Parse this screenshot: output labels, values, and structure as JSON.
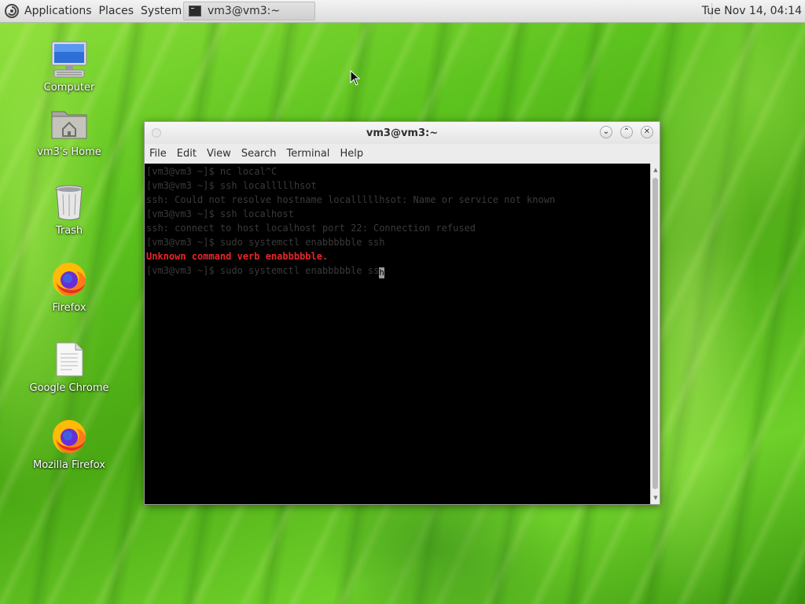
{
  "top_panel": {
    "menus": [
      "Applications",
      "Places",
      "System"
    ],
    "task_title": "vm3@vm3:~",
    "clock": "Tue Nov 14, 04:14"
  },
  "desktop": {
    "icons": [
      {
        "label": "Computer",
        "icon": "computer-icon"
      },
      {
        "label": "vm3's Home",
        "icon": "home-folder-icon"
      },
      {
        "label": "Trash",
        "icon": "trash-icon"
      },
      {
        "label": "Firefox",
        "icon": "firefox-icon"
      },
      {
        "label": "Google Chrome",
        "icon": "document-icon"
      },
      {
        "label": "Mozilla Firefox",
        "icon": "firefox-icon"
      }
    ]
  },
  "terminal": {
    "title": "vm3@vm3:~",
    "menus": [
      "File",
      "Edit",
      "View",
      "Search",
      "Terminal",
      "Help"
    ],
    "lines": [
      "[vm3@vm3 ~]$ nc local^C",
      "[vm3@vm3 ~]$ ssh localllllhsot",
      "ssh: Could not resolve hostname localllllhsot: Name or service not known",
      "[vm3@vm3 ~]$ ssh localhost",
      "ssh: connect to host localhost port 22: Connection refused",
      "[vm3@vm3 ~]$ sudo systemctl enabbbbble ssh",
      "Unknown command verb enabbbbble.",
      "[vm3@vm3 ~]$ sudo systemctl enabbbbble ss"
    ],
    "cursor_char": "h",
    "error_color": "#e8262a"
  }
}
